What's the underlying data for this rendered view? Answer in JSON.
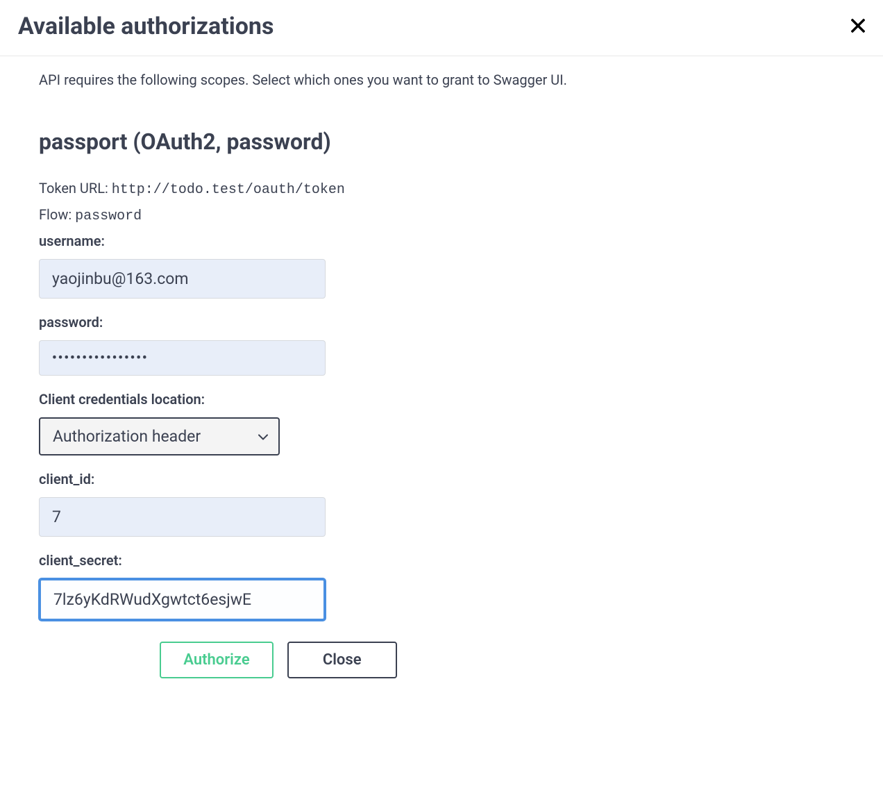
{
  "modal": {
    "title": "Available authorizations",
    "scope_text": "API requires the following scopes. Select which ones you want to grant to Swagger UI."
  },
  "auth": {
    "section_title": "passport (OAuth2, password)",
    "token_url_label": "Token URL: ",
    "token_url_value": "http://todo.test/oauth/token",
    "flow_label": "Flow: ",
    "flow_value": "password",
    "fields": {
      "username_label": "username:",
      "username_value": "yaojinbu@163.com",
      "password_label": "password:",
      "password_value": "••••••••••••••••",
      "credentials_location_label": "Client credentials location:",
      "credentials_location_value": "Authorization header",
      "client_id_label": "client_id:",
      "client_id_value": "7",
      "client_secret_label": "client_secret:",
      "client_secret_value": "7lz6yKdRWudXgwtct6esjwE"
    }
  },
  "buttons": {
    "authorize": "Authorize",
    "close": "Close"
  }
}
